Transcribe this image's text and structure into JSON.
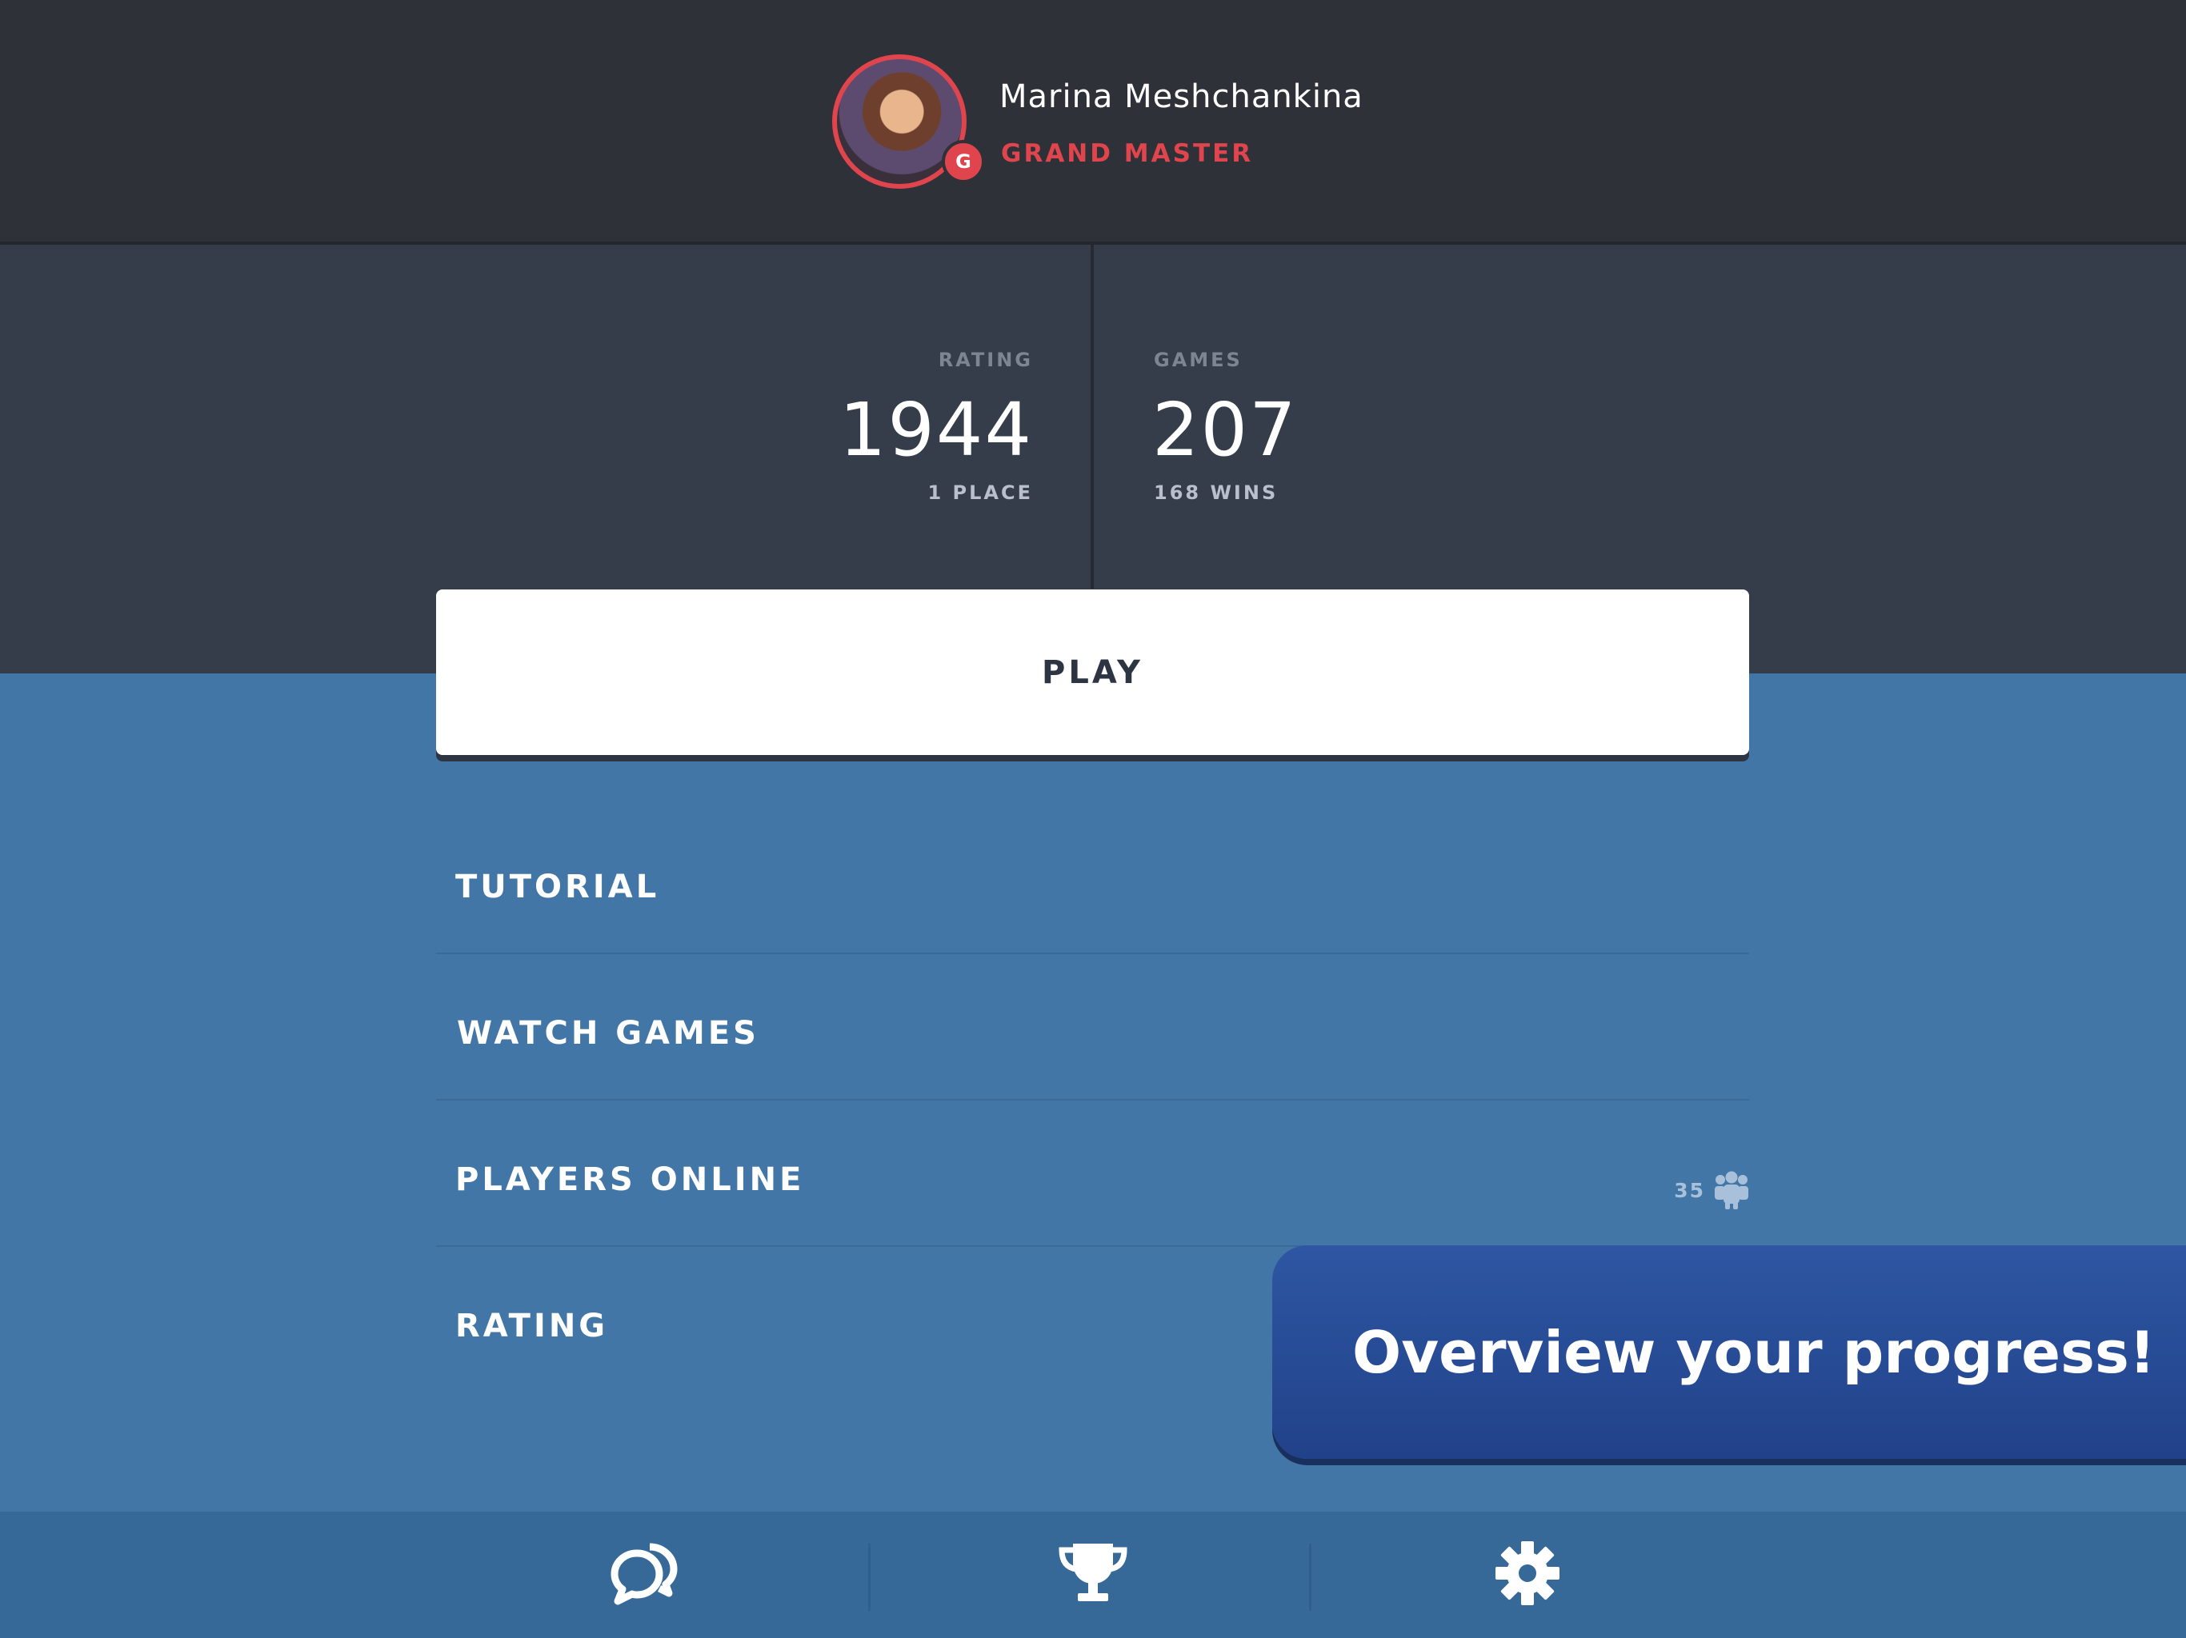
{
  "profile": {
    "name": "Marina Meshchankina",
    "rank": "GRAND MASTER",
    "rank_badge": "G",
    "accent_color": "#e0444c"
  },
  "stats": {
    "rating": {
      "label": "RATING",
      "value": "1944",
      "sub": "1 PLACE"
    },
    "games": {
      "label": "GAMES",
      "value": "207",
      "sub": "168 WINS"
    }
  },
  "play_button": {
    "label": "PLAY"
  },
  "menu": {
    "items": [
      {
        "label": "TUTORIAL"
      },
      {
        "label": "WATCH GAMES"
      },
      {
        "label": "PLAYERS ONLINE",
        "count": "35"
      },
      {
        "label": "RATING"
      }
    ]
  },
  "promo": {
    "text": "Overview your progress!"
  },
  "bottom_bar": {
    "icons": [
      "chat-icon",
      "trophy-icon",
      "gear-icon"
    ]
  },
  "colors": {
    "header_bg": "#2e3138",
    "stats_bg": "#353d4a",
    "main_bg": "#4176a6",
    "bottom_bar_bg": "#376998",
    "promo_bg": "#2a4f9a"
  }
}
